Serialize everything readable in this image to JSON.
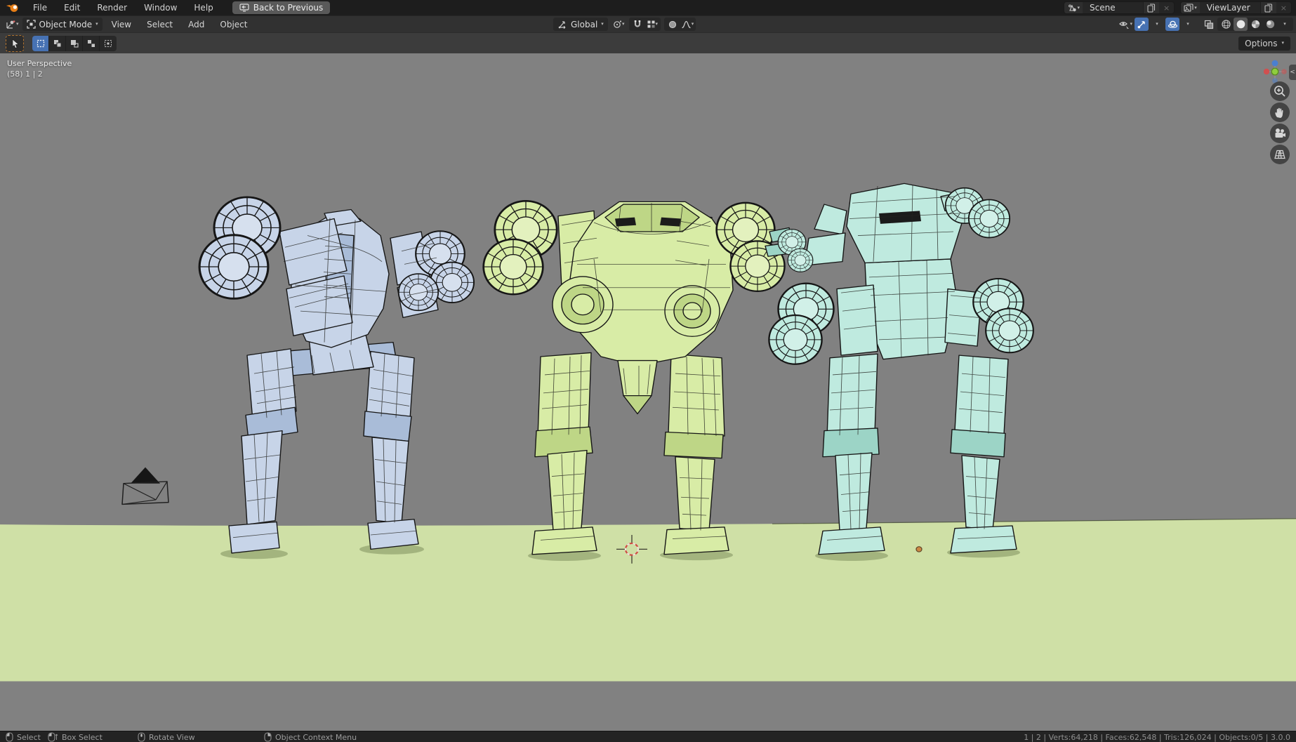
{
  "topbar": {
    "menus": [
      "File",
      "Edit",
      "Render",
      "Window",
      "Help"
    ],
    "back_button": "Back to Previous",
    "scene": "Scene",
    "view_layer": "ViewLayer"
  },
  "viewport_header": {
    "mode": "Object Mode",
    "menus": [
      "View",
      "Select",
      "Add",
      "Object"
    ],
    "orientation": "Global"
  },
  "tool_header": {
    "options": "Options"
  },
  "viewport": {
    "perspective_label": "User Perspective",
    "collection_label": "(58) 1 | 2"
  },
  "statusbar": {
    "hints": [
      {
        "label": "Select"
      },
      {
        "label": "Box Select"
      },
      {
        "label": "Rotate View"
      },
      {
        "label": "Object Context Menu"
      }
    ],
    "stats": "1 | 2 | Verts:64,218 | Faces:62,548 | Tris:126,024 | Objects:0/5 | 3.0.0"
  },
  "glyphs": {
    "caret": "▾",
    "close": "×",
    "sidebar_toggle": "<"
  },
  "colors": {
    "accent": "#4772b3",
    "blender_orange": "#ea7600",
    "viewport_bg": "#818181",
    "ground": "#cfe0a6",
    "robot_blue": "#c7d4e8",
    "robot_blue_dark": "#a9bcd8",
    "robot_green": "#d8eca6",
    "robot_green_dark": "#bed686",
    "robot_cyan": "#bfeadf",
    "robot_cyan_dark": "#9cd4c6"
  }
}
